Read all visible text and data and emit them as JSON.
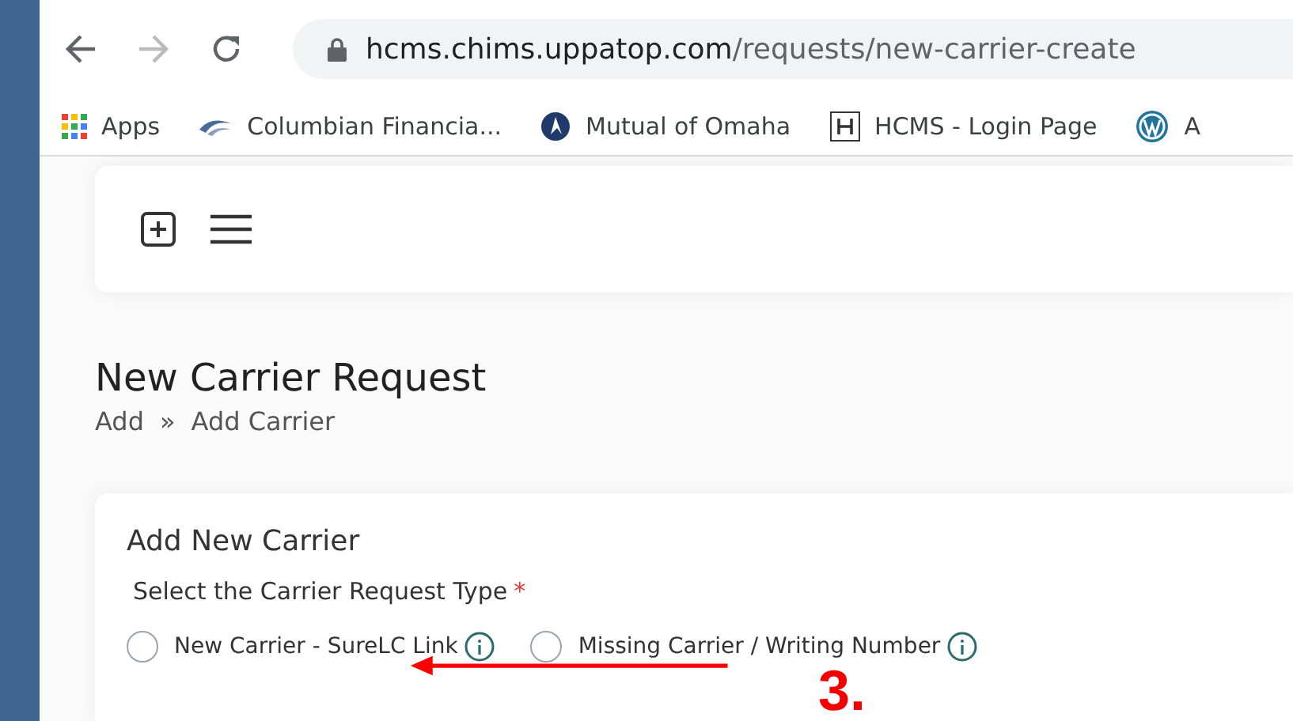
{
  "browser": {
    "url_host": "hcms.chims.uppatop.com",
    "url_path": "/requests/new-carrier-create",
    "bookmarks": [
      {
        "kind": "apps",
        "label": "Apps"
      },
      {
        "kind": "cf",
        "label": "Columbian Financia..."
      },
      {
        "kind": "mutual",
        "label": "Mutual of Omaha"
      },
      {
        "kind": "hcms",
        "label": "HCMS - Login Page"
      },
      {
        "kind": "wp",
        "label": "A"
      }
    ]
  },
  "page": {
    "title": "New Carrier Request",
    "breadcrumb": [
      "Add",
      "»",
      "Add Carrier"
    ],
    "card": {
      "title": "Add New Carrier",
      "field_label": "Select the Carrier Request Type",
      "required_mark": "*",
      "options": [
        {
          "label": "New Carrier - SureLC Link",
          "selected": false
        },
        {
          "label": "Missing Carrier / Writing Number",
          "selected": false
        }
      ]
    }
  },
  "annotation": {
    "label": "3."
  }
}
